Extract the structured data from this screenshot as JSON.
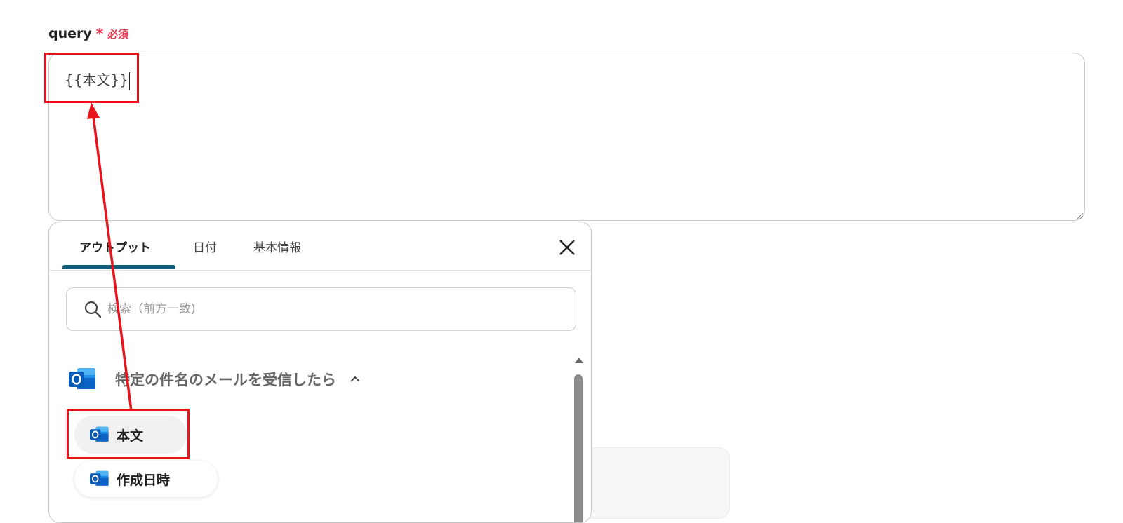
{
  "field": {
    "label": "query",
    "required_star": "*",
    "required_text": "必須",
    "value": "{{本文}}"
  },
  "panel": {
    "tabs": [
      {
        "label": "アウトプット",
        "active": true
      },
      {
        "label": "日付",
        "active": false
      },
      {
        "label": "基本情報",
        "active": false
      }
    ],
    "close_icon": "close-icon",
    "search": {
      "placeholder": "検索（前方一致)"
    },
    "section": {
      "title": "特定の件名のメールを受信したら",
      "icon": "outlook-icon",
      "expanded": true
    },
    "items": [
      {
        "label": "本文",
        "icon": "outlook-icon",
        "selected": true
      },
      {
        "label": "作成日時",
        "icon": "outlook-icon",
        "selected": false
      }
    ]
  },
  "colors": {
    "required": "#e8384f",
    "highlight": "#e8131b",
    "tab_active_underline": "#0d5f7a",
    "outlook_blue": "#0a64c8"
  }
}
